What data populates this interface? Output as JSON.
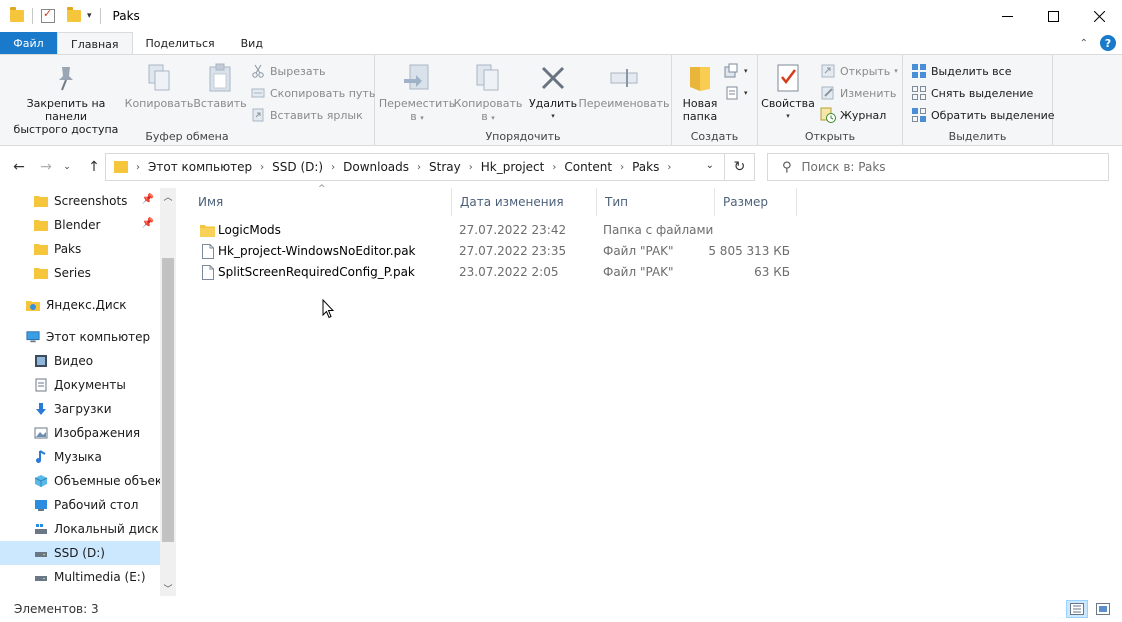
{
  "window": {
    "title": "Paks"
  },
  "tabs": [
    {
      "label": "Файл"
    },
    {
      "label": "Главная"
    },
    {
      "label": "Поделиться"
    },
    {
      "label": "Вид"
    }
  ],
  "ribbon": {
    "clipboard": {
      "label": "Буфер обмена",
      "pin_line1": "Закрепить на панели",
      "pin_line2": "быстрого доступа",
      "copy": "Копировать",
      "paste": "Вставить",
      "cut": "Вырезать",
      "copy_path": "Скопировать путь",
      "paste_shortcut": "Вставить ярлык"
    },
    "organize": {
      "label": "Упорядочить",
      "move_line1": "Переместить",
      "move_line2": "в",
      "copy_line1": "Копировать",
      "copy_line2": "в",
      "delete": "Удалить",
      "rename": "Переименовать"
    },
    "create": {
      "label": "Создать",
      "new_folder_line1": "Новая",
      "new_folder_line2": "папка"
    },
    "open": {
      "label": "Открыть",
      "properties": "Свойства",
      "open": "Открыть",
      "edit": "Изменить",
      "history": "Журнал"
    },
    "select": {
      "label": "Выделить",
      "select_all": "Выделить все",
      "select_none": "Снять выделение",
      "invert": "Обратить выделение"
    }
  },
  "address": {
    "crumbs": [
      "Этот компьютер",
      "SSD (D:)",
      "Downloads",
      "Stray",
      "Hk_project",
      "Content",
      "Paks"
    ]
  },
  "search": {
    "placeholder": "Поиск в: Paks"
  },
  "sidebar": {
    "items": [
      {
        "label": "Screenshots",
        "icon": "folder-icon"
      },
      {
        "label": "Blender",
        "icon": "folder-icon"
      },
      {
        "label": "Paks",
        "icon": "folder-icon"
      },
      {
        "label": "Series",
        "icon": "folder-icon"
      },
      {
        "label": "Яндекс.Диск",
        "icon": "yandex-disk-icon"
      },
      {
        "label": "Этот компьютер",
        "icon": "computer-icon"
      },
      {
        "label": "Видео",
        "icon": "video-icon"
      },
      {
        "label": "Документы",
        "icon": "documents-icon"
      },
      {
        "label": "Загрузки",
        "icon": "downloads-icon"
      },
      {
        "label": "Изображения",
        "icon": "pictures-icon"
      },
      {
        "label": "Музыка",
        "icon": "music-icon"
      },
      {
        "label": "Объемные объекты",
        "icon": "3d-objects-icon"
      },
      {
        "label": "Рабочий стол",
        "icon": "desktop-icon"
      },
      {
        "label": "Локальный диск (C:)",
        "icon": "drive-icon"
      },
      {
        "label": "SSD (D:)",
        "icon": "drive-icon"
      },
      {
        "label": "Multimedia (E:)",
        "icon": "drive-icon"
      }
    ]
  },
  "columns": {
    "name": "Имя",
    "date": "Дата изменения",
    "type": "Тип",
    "size": "Размер"
  },
  "files": [
    {
      "name": "LogicMods",
      "date": "27.07.2022 23:42",
      "type": "Папка с файлами",
      "size": "",
      "icon": "folder-icon"
    },
    {
      "name": "Hk_project-WindowsNoEditor.pak",
      "date": "27.07.2022 23:35",
      "type": "Файл \"PAK\"",
      "size": "5 805 313 КБ",
      "icon": "file-icon"
    },
    {
      "name": "SplitScreenRequiredConfig_P.pak",
      "date": "23.07.2022 2:05",
      "type": "Файл \"PAK\"",
      "size": "63 КБ",
      "icon": "file-icon"
    }
  ],
  "status": {
    "items_count": "Элементов: 3"
  }
}
